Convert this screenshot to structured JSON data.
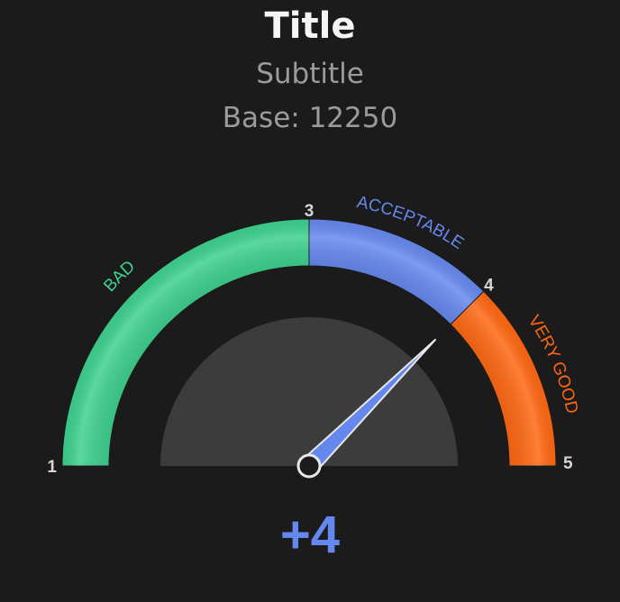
{
  "header": {
    "title": "Title",
    "subtitle": "Subtitle",
    "base_label": "Base:",
    "base_value": "12250"
  },
  "chart_data": {
    "type": "gauge",
    "min": 1,
    "max": 5,
    "value": 4,
    "value_label": "+4",
    "ticks": [
      {
        "value": 1,
        "label": "1"
      },
      {
        "value": 3,
        "label": "3"
      },
      {
        "value": 4,
        "label": "4"
      },
      {
        "value": 5,
        "label": "5"
      }
    ],
    "bands": [
      {
        "name": "BAD",
        "from": 1,
        "to": 3,
        "color": "#3dd08e"
      },
      {
        "name": "ACCEPTABLE",
        "from": 3,
        "to": 4,
        "color": "#6588ee"
      },
      {
        "name": "VERY GOOD",
        "from": 4,
        "to": 5,
        "color": "#ff6711"
      }
    ],
    "needle_color": "#6588ee",
    "inner_fill": "#3c3c3c"
  }
}
